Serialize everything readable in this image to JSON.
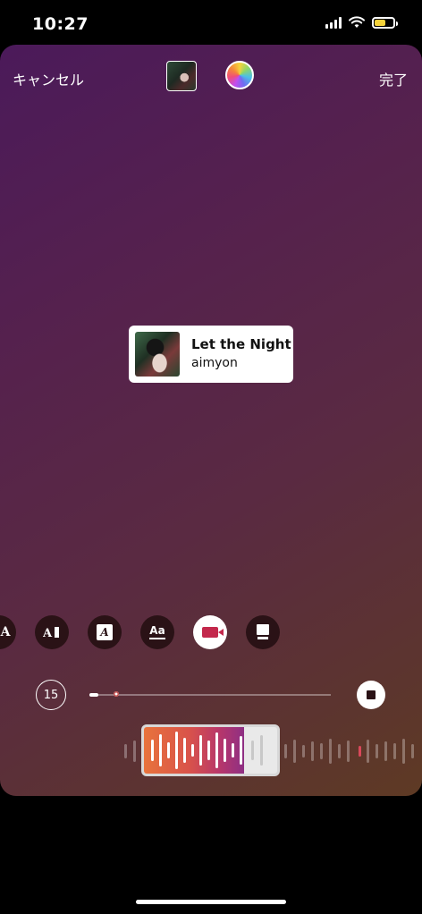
{
  "status_bar": {
    "time": "10:27"
  },
  "header": {
    "cancel_label": "キャンセル",
    "done_label": "完了"
  },
  "music_sticker": {
    "title": "Let the Night",
    "artist": "aimyon"
  },
  "sticker_styles": [
    {
      "name": "style-serif-a",
      "icon": "serif-a-icon"
    },
    {
      "name": "style-text-bar",
      "icon": "text-bar-icon"
    },
    {
      "name": "style-boxed-a",
      "icon": "boxed-a-icon"
    },
    {
      "name": "style-lyrics-aa",
      "icon": "lyrics-aa-icon"
    },
    {
      "name": "style-video-card",
      "icon": "video-card-icon",
      "selected": true
    },
    {
      "name": "style-card",
      "icon": "card-icon"
    }
  ],
  "playback": {
    "duration_label": "15",
    "progress_fraction": 0.1
  },
  "colors": {
    "selection_start": "#e8733c",
    "selection_end": "#8e2f84",
    "accent_red": "#c3284c"
  }
}
